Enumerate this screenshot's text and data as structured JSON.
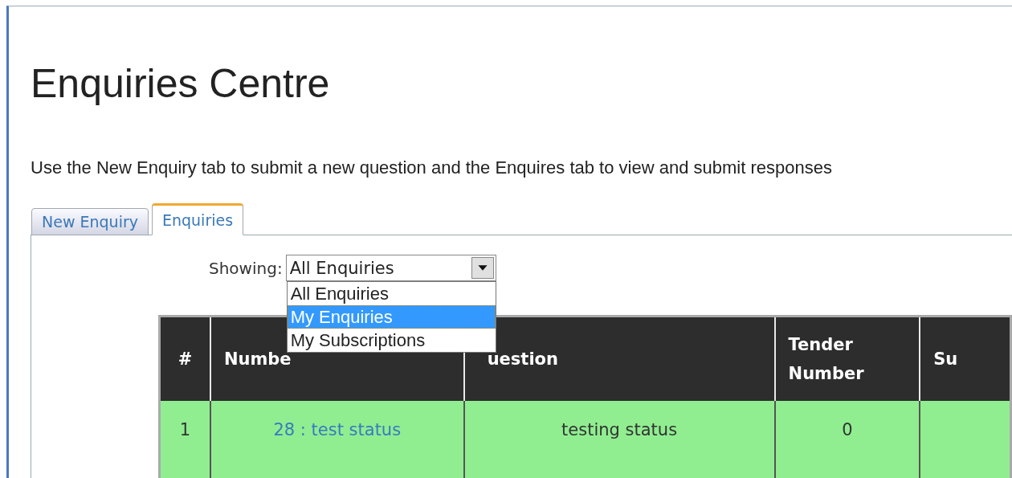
{
  "title": "Enquiries Centre",
  "intro": "Use the New Enquiry tab to submit a new question and the Enquires tab to view and submit responses",
  "tabs": [
    {
      "label": "New Enquiry",
      "selected": false
    },
    {
      "label": "Enquiries",
      "selected": true
    }
  ],
  "filter": {
    "label": "Showing:",
    "value": "All Enquiries",
    "expanded": true,
    "options": [
      {
        "label": "All Enquiries",
        "highlighted": false
      },
      {
        "label": "My Enquiries",
        "highlighted": true
      },
      {
        "label": "My Subscriptions",
        "highlighted": false
      }
    ]
  },
  "table": {
    "columns": [
      "#",
      "Numbe",
      "uestion",
      "Tender Number",
      "Su"
    ],
    "rows": [
      {
        "index": "1",
        "enquiry": "28 : test status",
        "question": "testing status",
        "tender_number": "0"
      }
    ]
  }
}
